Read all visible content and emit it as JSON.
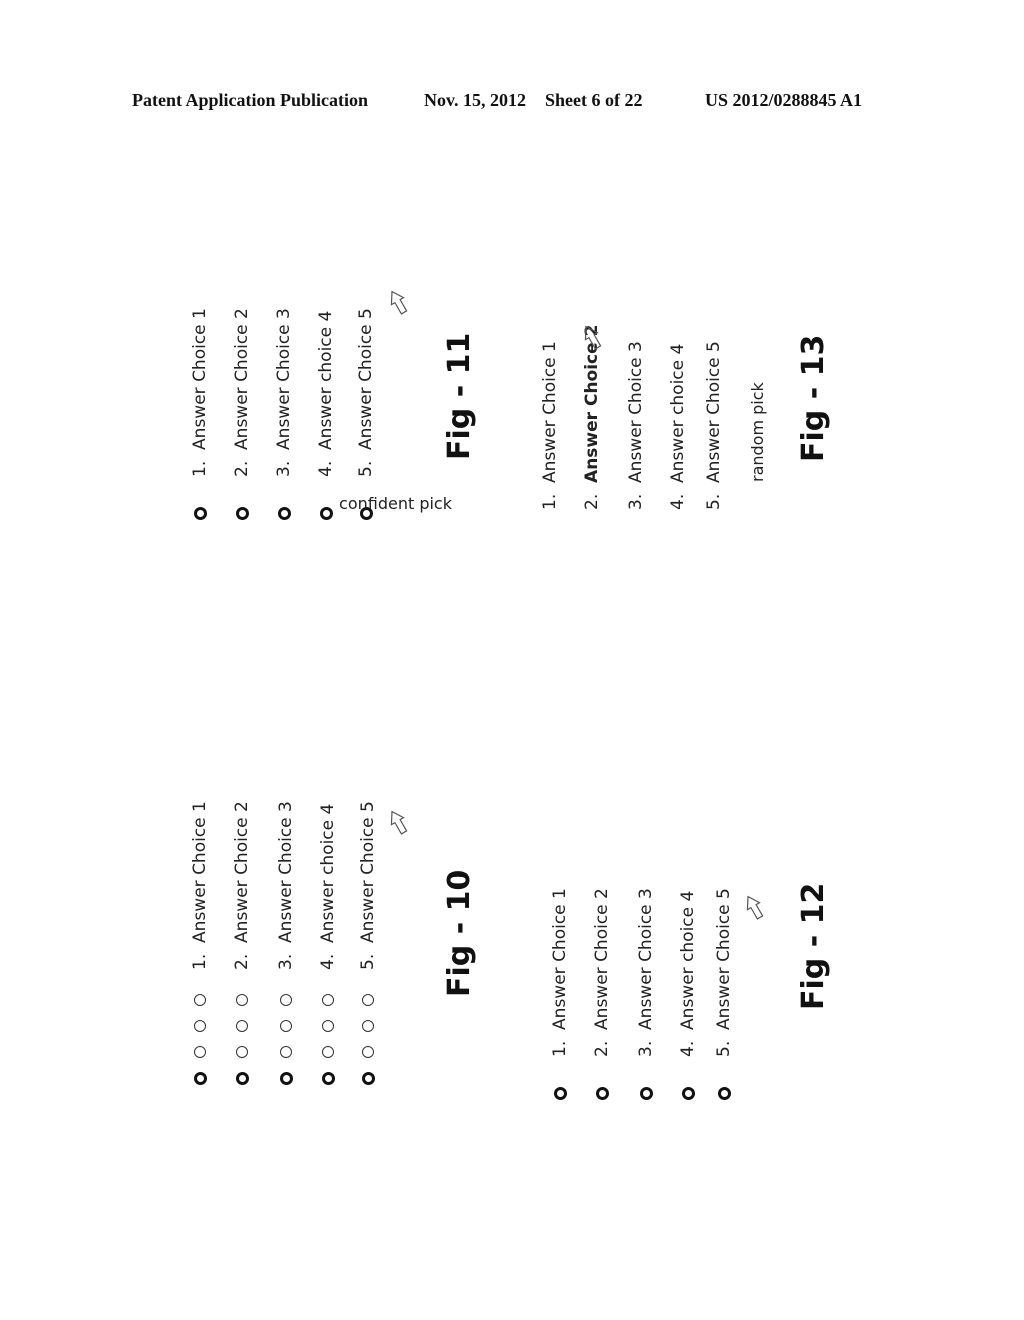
{
  "header": {
    "publication": "Patent Application Publication",
    "date": "Nov. 15, 2012",
    "sheet": "Sheet 6 of 22",
    "number": "US 2012/0288845 A1"
  },
  "figures": {
    "fig10": {
      "label": "Fig - 10",
      "radio_columns": 4,
      "choices": [
        {
          "num": "1.",
          "text": "Answer Choice 1"
        },
        {
          "num": "2.",
          "text": "Answer Choice 2"
        },
        {
          "num": "3.",
          "text": "Answer Choice 3"
        },
        {
          "num": "4.",
          "text": "Answer choice 4"
        },
        {
          "num": "5.",
          "text": "Answer Choice 5"
        }
      ],
      "arrow": "hollow-arrow-icon"
    },
    "fig11": {
      "label": "Fig - 11",
      "caption": "confident pick",
      "choices": [
        {
          "num": "1.",
          "text": "Answer Choice 1"
        },
        {
          "num": "2.",
          "text": "Answer Choice 2"
        },
        {
          "num": "3.",
          "text": "Answer Choice 3"
        },
        {
          "num": "4.",
          "text": "Answer choice 4"
        },
        {
          "num": "5.",
          "text": "Answer Choice 5"
        }
      ],
      "arrow": "hollow-arrow-icon"
    },
    "fig12": {
      "label": "Fig - 12",
      "choices": [
        {
          "num": "1.",
          "text": "Answer Choice 1"
        },
        {
          "num": "2.",
          "text": "Answer Choice 2"
        },
        {
          "num": "3.",
          "text": "Answer Choice 3"
        },
        {
          "num": "4.",
          "text": "Answer choice 4"
        },
        {
          "num": "5.",
          "text": "Answer Choice 5"
        }
      ],
      "arrow": "hollow-arrow-icon"
    },
    "fig13": {
      "label": "Fig - 13",
      "caption": "random pick",
      "highlighted_choice": 2,
      "choices": [
        {
          "num": "1.",
          "text": "Answer Choice 1"
        },
        {
          "num": "2.",
          "text": "Answer Choice 2"
        },
        {
          "num": "3.",
          "text": "Answer Choice 3"
        },
        {
          "num": "4.",
          "text": "Answer choice 4"
        },
        {
          "num": "5.",
          "text": "Answer Choice 5"
        }
      ],
      "arrow": "hollow-arrow-icon"
    }
  }
}
